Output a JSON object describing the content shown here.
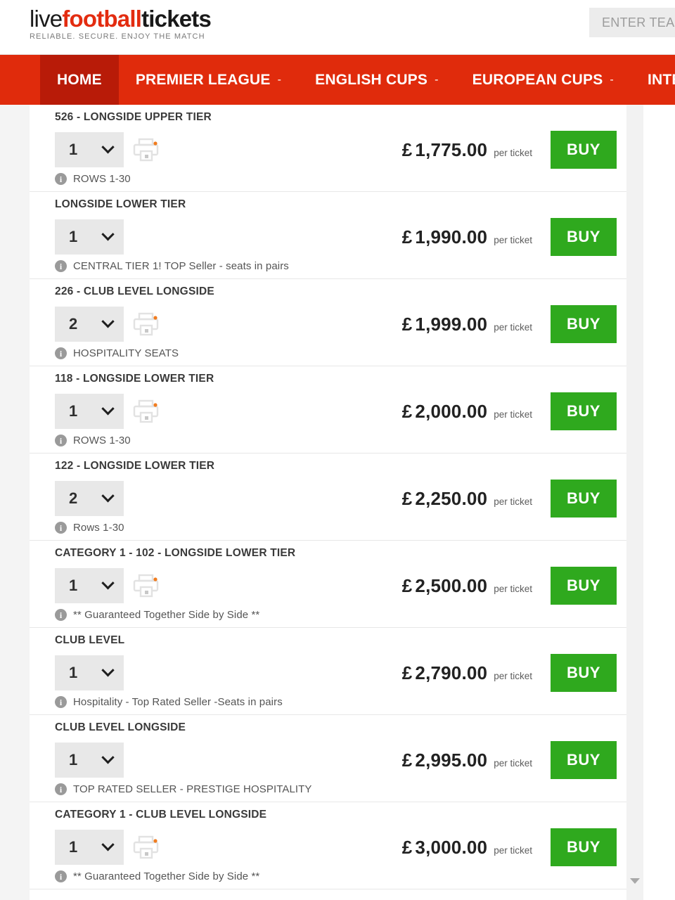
{
  "brand": {
    "name_part1": "live",
    "name_part2": "football",
    "name_part3": "tickets",
    "tagline": "RELIABLE. SECURE. ENJOY THE MATCH"
  },
  "search": {
    "placeholder": "ENTER TEAM",
    "value": ""
  },
  "nav": {
    "items": [
      {
        "label": "HOME",
        "caret": "",
        "active": true
      },
      {
        "label": "PREMIER LEAGUE",
        "caret": "-",
        "active": false
      },
      {
        "label": "ENGLISH CUPS",
        "caret": "-",
        "active": false
      },
      {
        "label": "EUROPEAN CUPS",
        "caret": "-",
        "active": false
      },
      {
        "label": "INTERNATIONAL",
        "caret": "",
        "active": false
      }
    ]
  },
  "listing": {
    "currency_symbol": "£",
    "per_ticket_label": "per ticket",
    "buy_label": "BUY",
    "rows": [
      {
        "title": "526 - LONGSIDE UPPER TIER",
        "qty": "1",
        "eticket": true,
        "price": "1,775.00",
        "note": "ROWS 1-30"
      },
      {
        "title": "LONGSIDE LOWER TIER",
        "qty": "1",
        "eticket": false,
        "price": "1,990.00",
        "note": "CENTRAL TIER 1! TOP Seller - seats in pairs"
      },
      {
        "title": "226 - CLUB LEVEL LONGSIDE",
        "qty": "2",
        "eticket": true,
        "price": "1,999.00",
        "note": "HOSPITALITY SEATS"
      },
      {
        "title": "118 - LONGSIDE LOWER TIER",
        "qty": "1",
        "eticket": true,
        "price": "2,000.00",
        "note": "ROWS 1-30"
      },
      {
        "title": "122 - LONGSIDE LOWER TIER",
        "qty": "2",
        "eticket": false,
        "price": "2,250.00",
        "note": "Rows 1-30"
      },
      {
        "title": "CATEGORY 1 - 102 - LONGSIDE LOWER TIER",
        "qty": "1",
        "eticket": true,
        "price": "2,500.00",
        "note": "** Guaranteed Together Side by Side **"
      },
      {
        "title": "CLUB LEVEL",
        "qty": "1",
        "eticket": false,
        "price": "2,790.00",
        "note": "Hospitality - Top Rated Seller -Seats in pairs"
      },
      {
        "title": "CLUB LEVEL LONGSIDE",
        "qty": "1",
        "eticket": false,
        "price": "2,995.00",
        "note": "TOP RATED SELLER - PRESTIGE HOSPITALITY"
      },
      {
        "title": "CATEGORY 1 - CLUB LEVEL LONGSIDE",
        "qty": "1",
        "eticket": true,
        "price": "3,000.00",
        "note": "** Guaranteed Together Side by Side **"
      }
    ]
  },
  "colors": {
    "brand_red": "#e02b0c",
    "nav_active_red": "#b81b08",
    "buy_green": "#2fa91e",
    "logo_red": "#e32c10"
  },
  "icons": {
    "info": "i",
    "eticket": "printer-icon",
    "scroll_down": "chevron-down"
  }
}
